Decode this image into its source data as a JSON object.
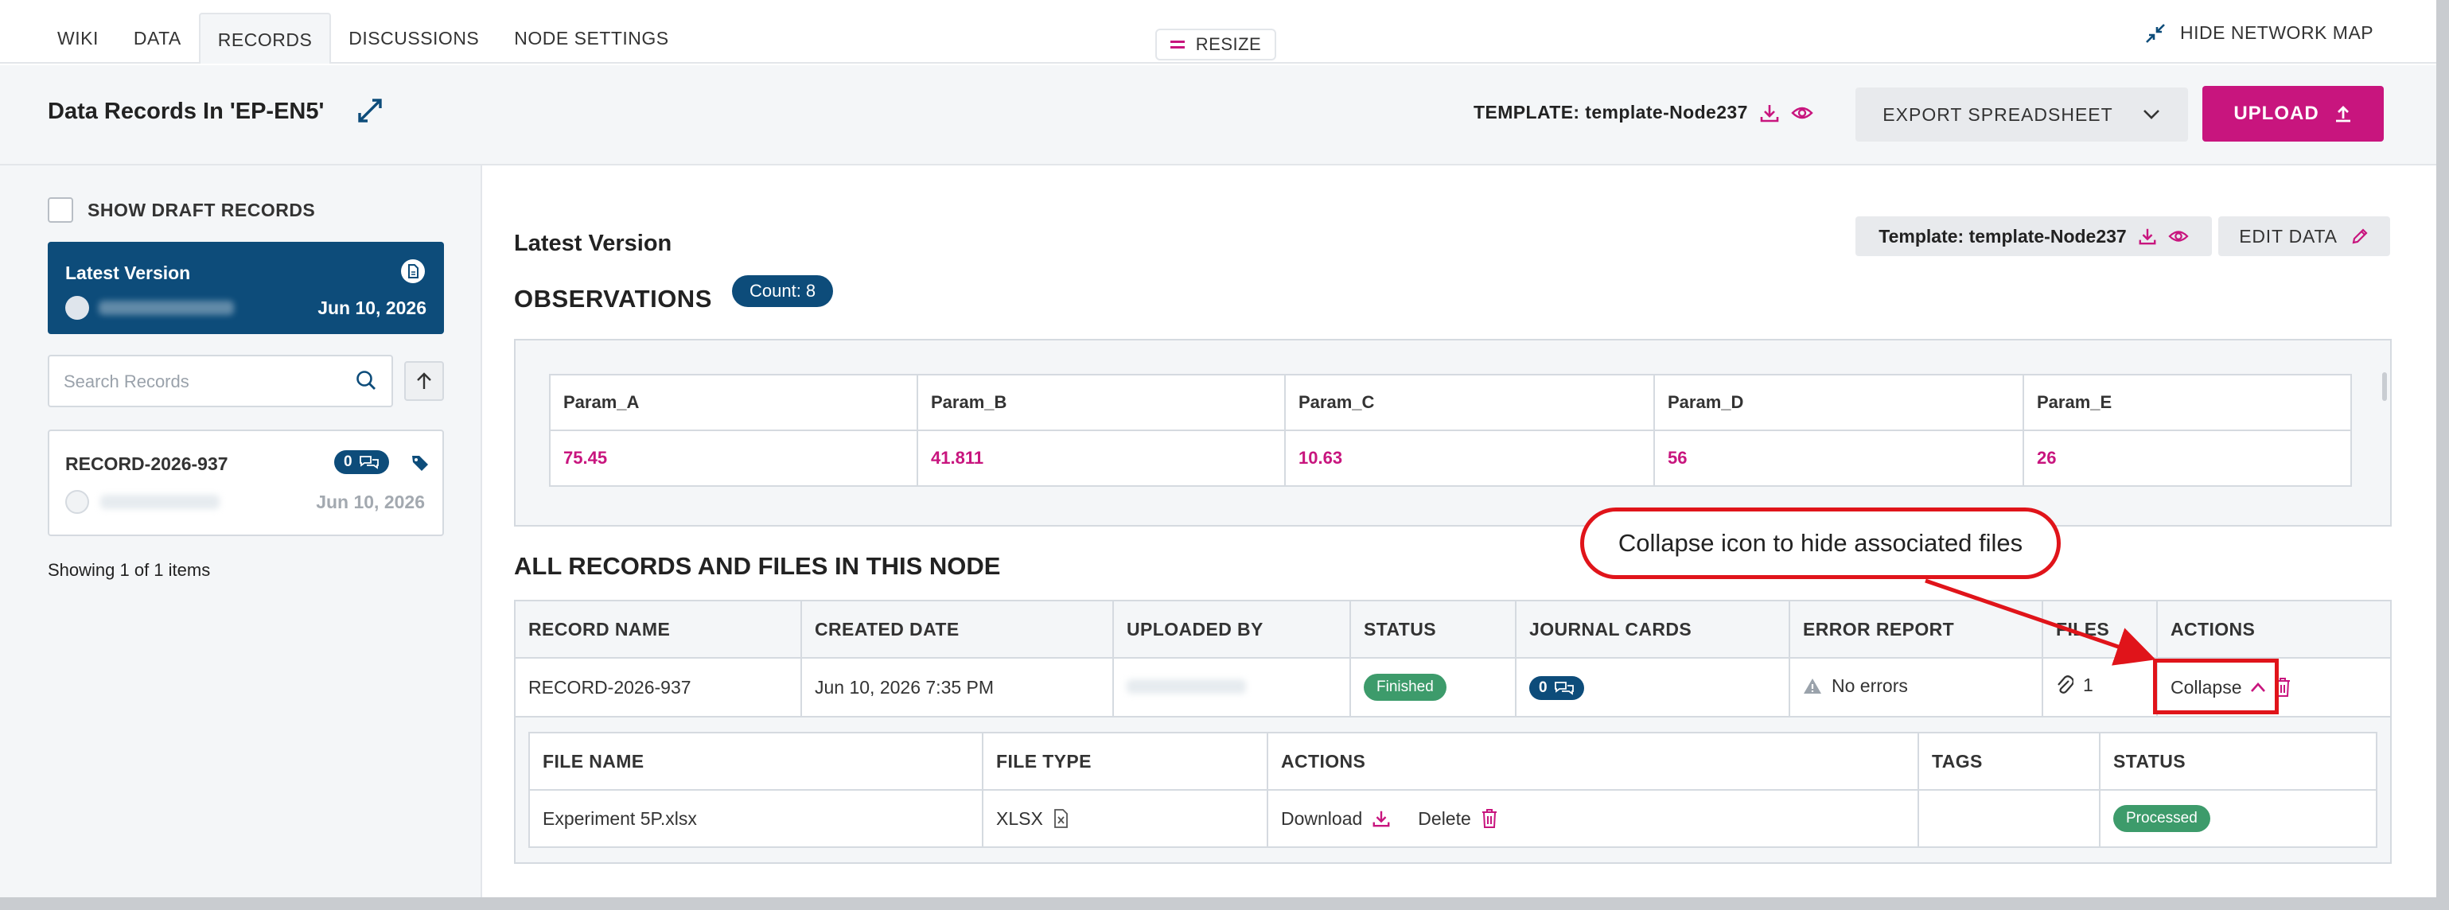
{
  "nav": {
    "tabs": [
      {
        "label": "WIKI"
      },
      {
        "label": "DATA"
      },
      {
        "label": "RECORDS"
      },
      {
        "label": "DISCUSSIONS"
      },
      {
        "label": "NODE SETTINGS"
      }
    ],
    "active_tab": "RECORDS",
    "resize_label": "RESIZE",
    "hide_map_label": "HIDE NETWORK MAP"
  },
  "header": {
    "title": "Data Records In 'EP-EN5'",
    "template_label": "TEMPLATE: template-Node237",
    "export_label": "EXPORT SPREADSHEET",
    "upload_label": "UPLOAD"
  },
  "sidebar": {
    "draft_label": "SHOW DRAFT RECORDS",
    "draft_checked": false,
    "version": {
      "label": "Latest Version",
      "date": "Jun 10, 2026"
    },
    "search_placeholder": "Search Records",
    "record": {
      "name": "RECORD-2026-937",
      "comment_count": "0",
      "date": "Jun 10, 2026"
    },
    "showing": "Showing 1 of 1 items"
  },
  "main": {
    "latest_label": "Latest Version",
    "observations_title": "OBSERVATIONS",
    "count_label": "Count: 8",
    "template_chip": "Template: template-Node237",
    "edit_label": "EDIT DATA",
    "obs_columns": [
      "Param_A",
      "Param_B",
      "Param_C",
      "Param_D",
      "Param_E"
    ],
    "obs_values": [
      "75.45",
      "41.811",
      "10.63",
      "56",
      "26"
    ],
    "all_title": "ALL RECORDS AND FILES IN THIS NODE",
    "record_columns": [
      "RECORD NAME",
      "CREATED DATE",
      "UPLOADED BY",
      "STATUS",
      "JOURNAL CARDS",
      "ERROR REPORT",
      "FILES",
      "ACTIONS"
    ],
    "record_row": {
      "name": "RECORD-2026-937",
      "created": "Jun 10, 2026 7:35 PM",
      "status": "Finished",
      "journal_count": "0",
      "error_report": "No errors",
      "files": "1",
      "collapse_label": "Collapse"
    },
    "file_columns": [
      "FILE NAME",
      "FILE TYPE",
      "ACTIONS",
      "TAGS",
      "STATUS"
    ],
    "file_row": {
      "name": "Experiment 5P.xlsx",
      "type": "XLSX",
      "download_label": "Download",
      "delete_label": "Delete",
      "tags": "",
      "status": "Processed"
    }
  },
  "annotation": {
    "callout_text": "Collapse icon to hide associated files"
  },
  "colors": {
    "brand_magenta": "#c8157e",
    "brand_navy": "#0d4c7a",
    "success_green": "#3d9b6b",
    "annotation_red": "#e0141a"
  }
}
